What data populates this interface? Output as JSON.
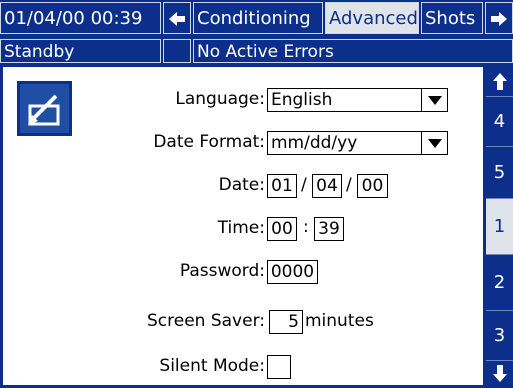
{
  "header": {
    "datetime": "01/04/00 00:39",
    "tabs": [
      "Conditioning",
      "Advanced",
      "Shots"
    ],
    "active_tab": "Advanced"
  },
  "status": {
    "mode": "Standby",
    "errors": "No Active Errors"
  },
  "form": {
    "language_label": "Language:",
    "language_value": "English",
    "date_format_label": "Date Format:",
    "date_format_value": "mm/dd/yy",
    "date_label": "Date:",
    "date_month": "01",
    "date_day": "04",
    "date_year": "00",
    "date_sep": "/",
    "time_label": "Time:",
    "time_hour": "00",
    "time_minute": "39",
    "time_sep": ":",
    "password_label": "Password:",
    "password_value": "0000",
    "screen_saver_label": "Screen Saver:",
    "screen_saver_value": "5",
    "screen_saver_unit": "minutes",
    "silent_mode_label": "Silent Mode:",
    "silent_mode_checked": false
  },
  "side_tabs": [
    "4",
    "5",
    "1",
    "2",
    "3"
  ],
  "side_active": "1"
}
